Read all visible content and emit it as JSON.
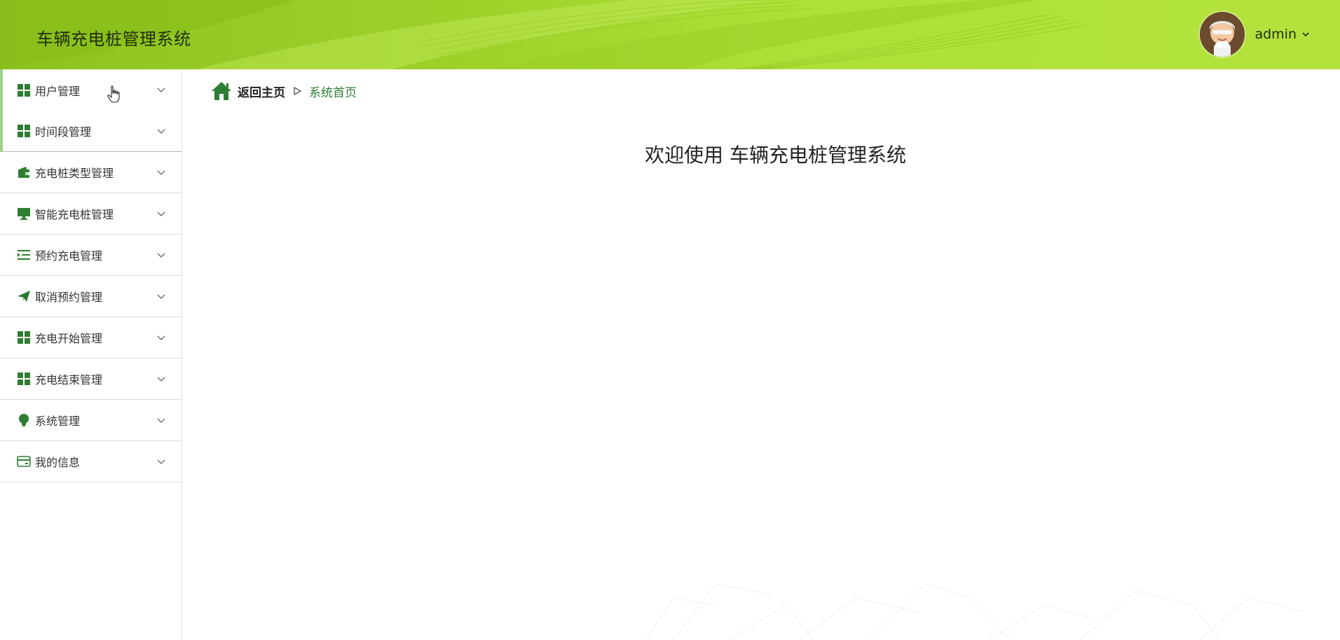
{
  "header": {
    "app_title": "车辆充电桩管理系统",
    "username": "admin",
    "avatar_icon": "user-avatar",
    "colors": {
      "header_start": "#8dc21f",
      "header_end": "#b4e23c"
    }
  },
  "sidebar": {
    "items": [
      {
        "label": "用户管理",
        "icon": "grid-icon"
      },
      {
        "label": "时间段管理",
        "icon": "grid-icon"
      },
      {
        "label": "充电桩类型管理",
        "icon": "wallet-icon"
      },
      {
        "label": "智能充电桩管理",
        "icon": "monitor-icon"
      },
      {
        "label": "预约充电管理",
        "icon": "list-icon"
      },
      {
        "label": "取消预约管理",
        "icon": "send-icon"
      },
      {
        "label": "充电开始管理",
        "icon": "grid-icon"
      },
      {
        "label": "充电结束管理",
        "icon": "grid-icon"
      },
      {
        "label": "系统管理",
        "icon": "bulb-icon"
      },
      {
        "label": "我的信息",
        "icon": "card-icon"
      }
    ],
    "accent_color": "#2e7d32"
  },
  "breadcrumb": {
    "home": "返回主页",
    "current": "系统首页"
  },
  "main": {
    "welcome": "欢迎使用 车辆充电桩管理系统"
  }
}
